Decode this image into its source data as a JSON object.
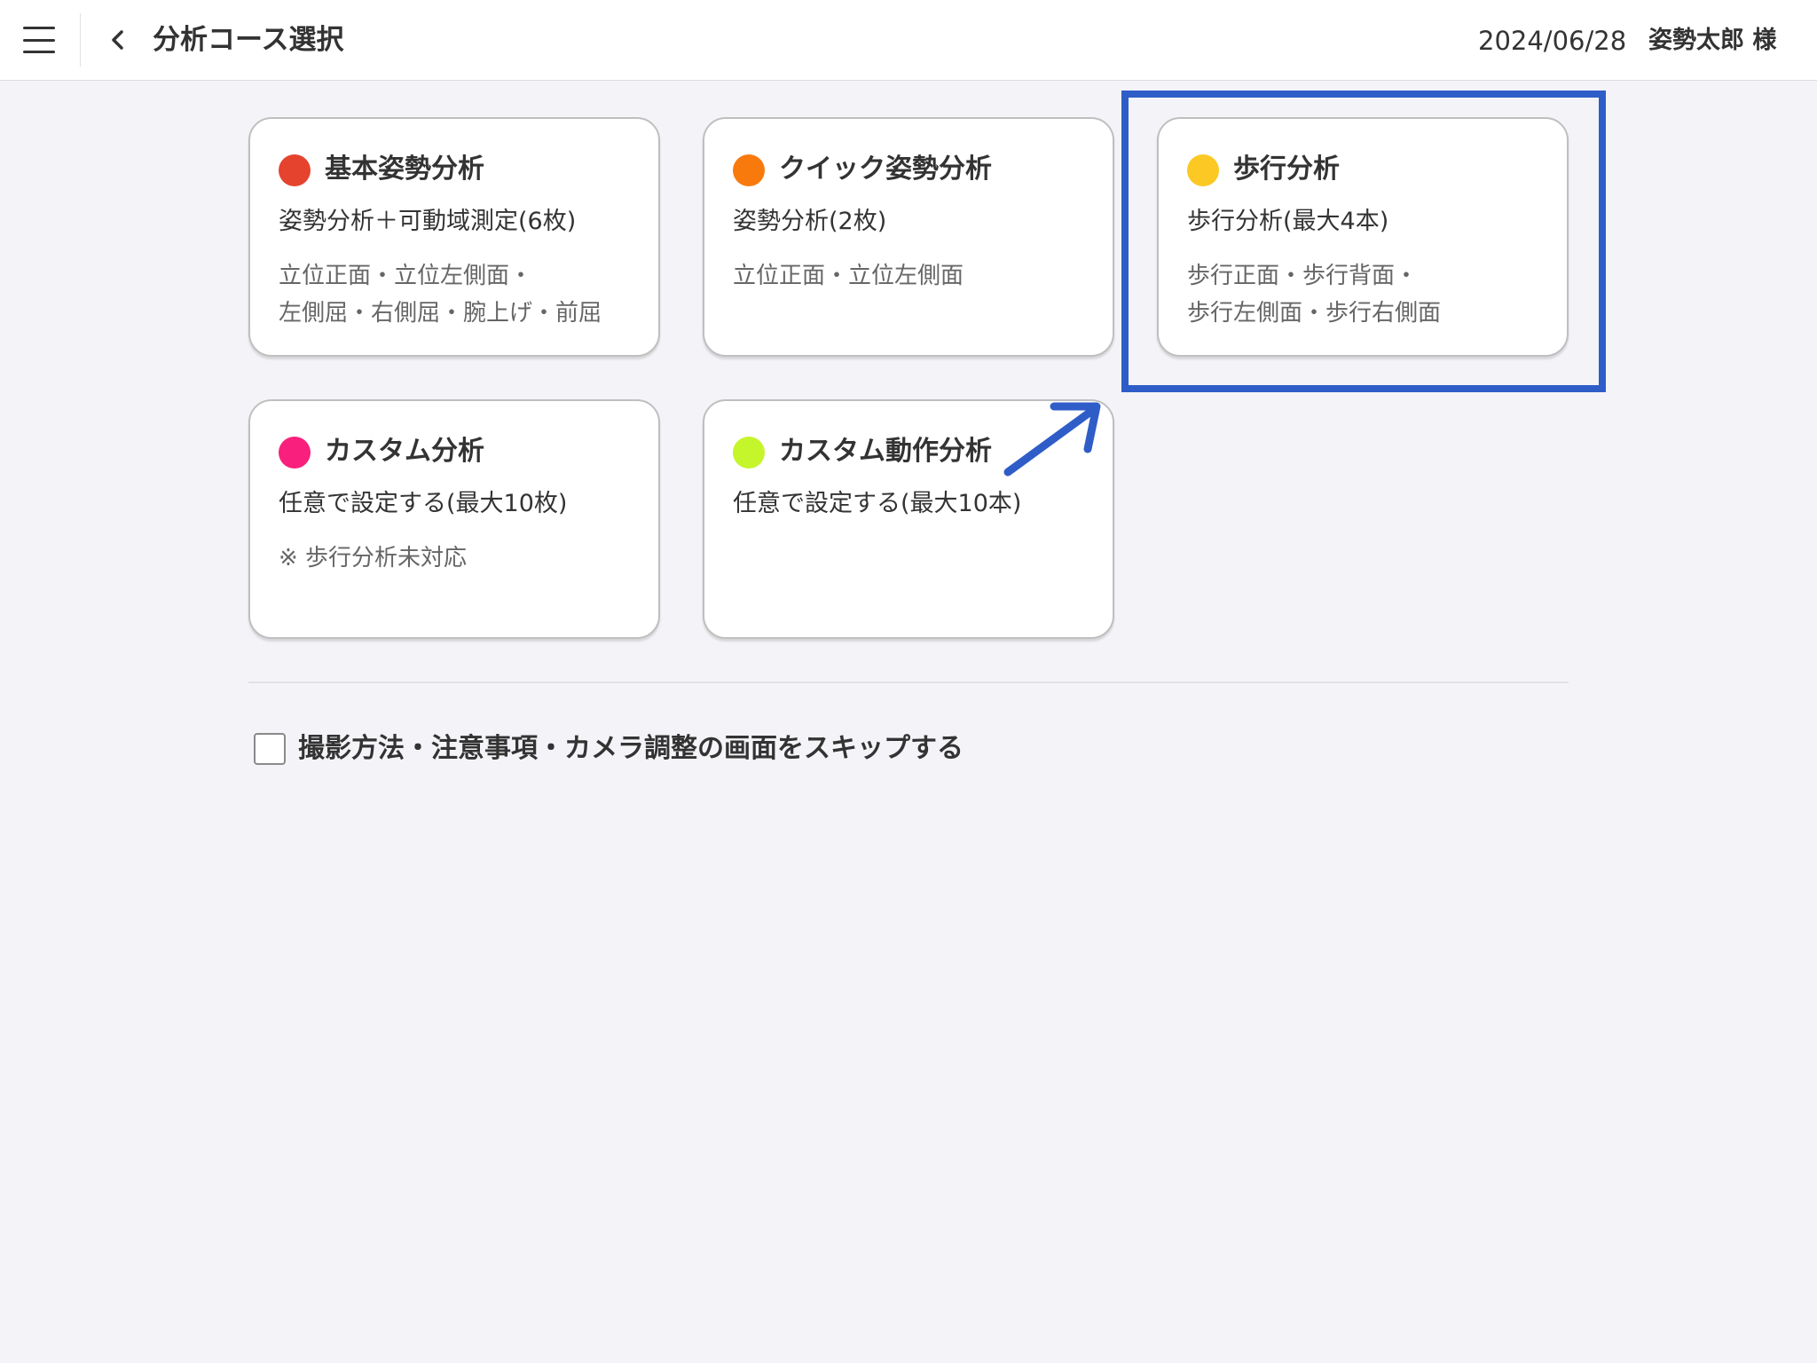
{
  "header": {
    "title": "分析コース選択",
    "date": "2024/06/28",
    "user": "姿勢太郎 様"
  },
  "cards": [
    {
      "title": "基本姿勢分析",
      "subtitle": "姿勢分析＋可動域測定(6枚)",
      "desc_line1": "立位正面・立位左側面・",
      "desc_line2": "左側屈・右側屈・腕上げ・前屈",
      "dot_color": "#e5432e"
    },
    {
      "title": "クイック姿勢分析",
      "subtitle": "姿勢分析(2枚)",
      "desc_line1": "立位正面・立位左側面",
      "desc_line2": "",
      "dot_color": "#f97a0c"
    },
    {
      "title": "歩行分析",
      "subtitle": "歩行分析(最大4本)",
      "desc_line1": "歩行正面・歩行背面・",
      "desc_line2": "歩行左側面・歩行右側面",
      "dot_color": "#fcc823"
    },
    {
      "title": "カスタム分析",
      "subtitle": "任意で設定する(最大10枚)",
      "desc_line1": "※ 歩行分析未対応",
      "desc_line2": "",
      "dot_color": "#f91f7c"
    },
    {
      "title": "カスタム動作分析",
      "subtitle": "任意で設定する(最大10本)",
      "desc_line1": "",
      "desc_line2": "",
      "dot_color": "#c5f52b"
    }
  ],
  "skip_option": {
    "label": "撮影方法・注意事項・カメラ調整の画面をスキップする",
    "checked": false
  },
  "annotation": {
    "highlight_color": "#2f5dc8"
  }
}
